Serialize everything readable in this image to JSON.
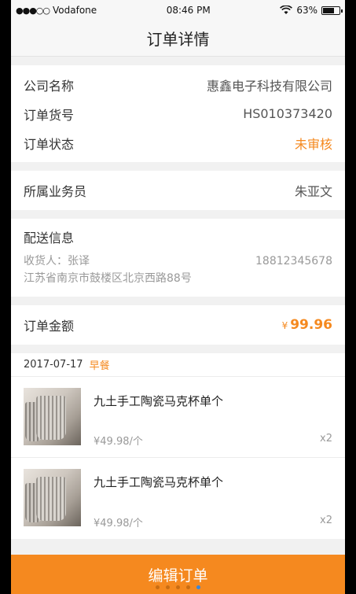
{
  "status_bar": {
    "carrier": "Vodafone",
    "signal": "●●●○○",
    "time": "08:46 PM",
    "battery": "63%"
  },
  "nav": {
    "title": "订单详情"
  },
  "info": {
    "company_label": "公司名称",
    "company_value": "惠鑫电子科技有限公司",
    "order_no_label": "订单货号",
    "order_no_value": "HS010373420",
    "status_label": "订单状态",
    "status_value": "未审核"
  },
  "salesperson": {
    "label": "所属业务员",
    "value": "朱亚文"
  },
  "delivery": {
    "title": "配送信息",
    "receiver": "收货人：张译",
    "phone": "18812345678",
    "address": "江苏省南京市鼓楼区北京西路88号"
  },
  "amount": {
    "label": "订单金额",
    "currency": "¥",
    "value": "99.96"
  },
  "order_group": {
    "date": "2017-07-17",
    "meal": "早餐"
  },
  "products": [
    {
      "name": "九土手工陶瓷马克杯单个",
      "price": "¥49.98/个",
      "qty": "x2"
    },
    {
      "name": "九土手工陶瓷马克杯单个",
      "price": "¥49.98/个",
      "qty": "x2"
    }
  ],
  "footer": {
    "button_label": "编辑订单"
  },
  "colors": {
    "accent": "#f5891f",
    "background": "#f1f1f1"
  }
}
